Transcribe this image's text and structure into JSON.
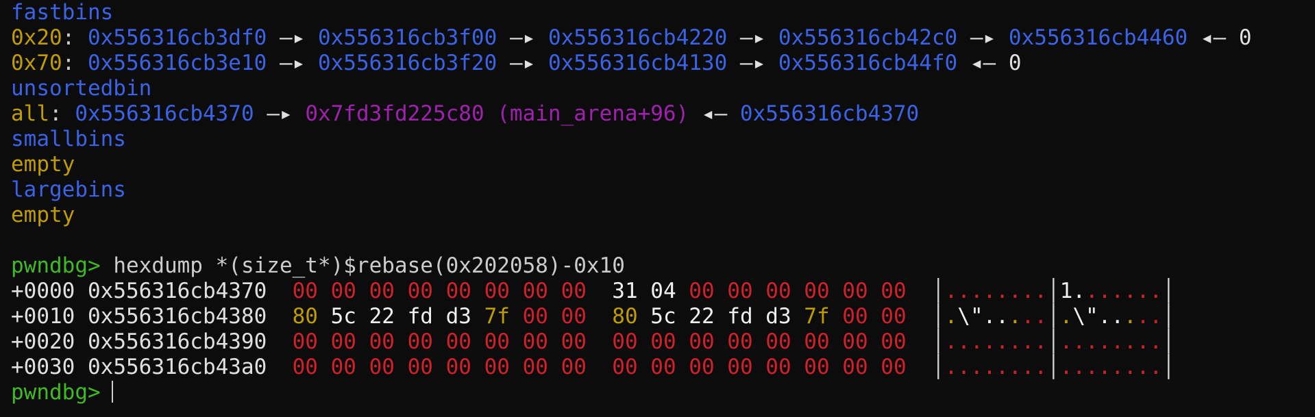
{
  "bins": {
    "fastbins_label": "fastbins",
    "fast_rows": [
      {
        "key": "0x20",
        "chain": [
          "0x556316cb3df0",
          "0x556316cb3f00",
          "0x556316cb4220",
          "0x556316cb42c0",
          "0x556316cb4460"
        ],
        "terminal": "0"
      },
      {
        "key": "0x70",
        "chain": [
          "0x556316cb3e10",
          "0x556316cb3f20",
          "0x556316cb4130",
          "0x556316cb44f0"
        ],
        "terminal": "0"
      }
    ],
    "unsorted_label": "unsortedbin",
    "unsorted_row": {
      "key": "all",
      "first": "0x556316cb4370",
      "libc": "0x7fd3fd225c80 (main_arena+96)",
      "last": "0x556316cb4370"
    },
    "small_label": "smallbins",
    "small_value": "empty",
    "large_label": "largebins",
    "large_value": "empty"
  },
  "symbols": {
    "arrow": "—▸",
    "back_arrow": "◂—",
    "colon": ":"
  },
  "command": {
    "prompt": "pwndbg>",
    "text": "hexdump *(size_t*)$rebase(0x202058)-0x10"
  },
  "hexdump": {
    "rows": [
      {
        "offset": "+0000",
        "address": "0x556316cb4370",
        "bytes": [
          {
            "v": "00",
            "k": "zero"
          },
          {
            "v": "00",
            "k": "zero"
          },
          {
            "v": "00",
            "k": "zero"
          },
          {
            "v": "00",
            "k": "zero"
          },
          {
            "v": "00",
            "k": "zero"
          },
          {
            "v": "00",
            "k": "zero"
          },
          {
            "v": "00",
            "k": "zero"
          },
          {
            "v": "00",
            "k": "zero"
          },
          {
            "v": "31",
            "k": "norm"
          },
          {
            "v": "04",
            "k": "norm"
          },
          {
            "v": "00",
            "k": "zero"
          },
          {
            "v": "00",
            "k": "zero"
          },
          {
            "v": "00",
            "k": "zero"
          },
          {
            "v": "00",
            "k": "zero"
          },
          {
            "v": "00",
            "k": "zero"
          },
          {
            "v": "00",
            "k": "zero"
          }
        ],
        "ascii": [
          {
            "c": ".",
            "k": "zero"
          },
          {
            "c": ".",
            "k": "zero"
          },
          {
            "c": ".",
            "k": "zero"
          },
          {
            "c": ".",
            "k": "zero"
          },
          {
            "c": ".",
            "k": "zero"
          },
          {
            "c": ".",
            "k": "zero"
          },
          {
            "c": ".",
            "k": "zero"
          },
          {
            "c": ".",
            "k": "zero"
          },
          {
            "c": "1",
            "k": "norm"
          },
          {
            "c": ".",
            "k": "norm"
          },
          {
            "c": ".",
            "k": "zero"
          },
          {
            "c": ".",
            "k": "zero"
          },
          {
            "c": ".",
            "k": "zero"
          },
          {
            "c": ".",
            "k": "zero"
          },
          {
            "c": ".",
            "k": "zero"
          },
          {
            "c": ".",
            "k": "zero"
          }
        ]
      },
      {
        "offset": "+0010",
        "address": "0x556316cb4380",
        "bytes": [
          {
            "v": "80",
            "k": "addr"
          },
          {
            "v": "5c",
            "k": "norm"
          },
          {
            "v": "22",
            "k": "norm"
          },
          {
            "v": "fd",
            "k": "norm"
          },
          {
            "v": "d3",
            "k": "norm"
          },
          {
            "v": "7f",
            "k": "addr"
          },
          {
            "v": "00",
            "k": "zero"
          },
          {
            "v": "00",
            "k": "zero"
          },
          {
            "v": "80",
            "k": "addr"
          },
          {
            "v": "5c",
            "k": "norm"
          },
          {
            "v": "22",
            "k": "norm"
          },
          {
            "v": "fd",
            "k": "norm"
          },
          {
            "v": "d3",
            "k": "norm"
          },
          {
            "v": "7f",
            "k": "addr"
          },
          {
            "v": "00",
            "k": "zero"
          },
          {
            "v": "00",
            "k": "zero"
          }
        ],
        "ascii": [
          {
            "c": ".",
            "k": "addr"
          },
          {
            "c": "\\",
            "k": "norm"
          },
          {
            "c": "\"",
            "k": "norm"
          },
          {
            "c": ".",
            "k": "norm"
          },
          {
            "c": ".",
            "k": "norm"
          },
          {
            "c": ".",
            "k": "addr"
          },
          {
            "c": ".",
            "k": "zero"
          },
          {
            "c": ".",
            "k": "zero"
          },
          {
            "c": ".",
            "k": "addr"
          },
          {
            "c": "\\",
            "k": "norm"
          },
          {
            "c": "\"",
            "k": "norm"
          },
          {
            "c": ".",
            "k": "norm"
          },
          {
            "c": ".",
            "k": "norm"
          },
          {
            "c": ".",
            "k": "addr"
          },
          {
            "c": ".",
            "k": "zero"
          },
          {
            "c": ".",
            "k": "zero"
          }
        ]
      },
      {
        "offset": "+0020",
        "address": "0x556316cb4390",
        "bytes": [
          {
            "v": "00",
            "k": "zero"
          },
          {
            "v": "00",
            "k": "zero"
          },
          {
            "v": "00",
            "k": "zero"
          },
          {
            "v": "00",
            "k": "zero"
          },
          {
            "v": "00",
            "k": "zero"
          },
          {
            "v": "00",
            "k": "zero"
          },
          {
            "v": "00",
            "k": "zero"
          },
          {
            "v": "00",
            "k": "zero"
          },
          {
            "v": "00",
            "k": "zero"
          },
          {
            "v": "00",
            "k": "zero"
          },
          {
            "v": "00",
            "k": "zero"
          },
          {
            "v": "00",
            "k": "zero"
          },
          {
            "v": "00",
            "k": "zero"
          },
          {
            "v": "00",
            "k": "zero"
          },
          {
            "v": "00",
            "k": "zero"
          },
          {
            "v": "00",
            "k": "zero"
          }
        ],
        "ascii": [
          {
            "c": ".",
            "k": "zero"
          },
          {
            "c": ".",
            "k": "zero"
          },
          {
            "c": ".",
            "k": "zero"
          },
          {
            "c": ".",
            "k": "zero"
          },
          {
            "c": ".",
            "k": "zero"
          },
          {
            "c": ".",
            "k": "zero"
          },
          {
            "c": ".",
            "k": "zero"
          },
          {
            "c": ".",
            "k": "zero"
          },
          {
            "c": ".",
            "k": "zero"
          },
          {
            "c": ".",
            "k": "zero"
          },
          {
            "c": ".",
            "k": "zero"
          },
          {
            "c": ".",
            "k": "zero"
          },
          {
            "c": ".",
            "k": "zero"
          },
          {
            "c": ".",
            "k": "zero"
          },
          {
            "c": ".",
            "k": "zero"
          },
          {
            "c": ".",
            "k": "zero"
          }
        ]
      },
      {
        "offset": "+0030",
        "address": "0x556316cb43a0",
        "bytes": [
          {
            "v": "00",
            "k": "zero"
          },
          {
            "v": "00",
            "k": "zero"
          },
          {
            "v": "00",
            "k": "zero"
          },
          {
            "v": "00",
            "k": "zero"
          },
          {
            "v": "00",
            "k": "zero"
          },
          {
            "v": "00",
            "k": "zero"
          },
          {
            "v": "00",
            "k": "zero"
          },
          {
            "v": "00",
            "k": "zero"
          },
          {
            "v": "00",
            "k": "zero"
          },
          {
            "v": "00",
            "k": "zero"
          },
          {
            "v": "00",
            "k": "zero"
          },
          {
            "v": "00",
            "k": "zero"
          },
          {
            "v": "00",
            "k": "zero"
          },
          {
            "v": "00",
            "k": "zero"
          },
          {
            "v": "00",
            "k": "zero"
          },
          {
            "v": "00",
            "k": "zero"
          }
        ],
        "ascii": [
          {
            "c": ".",
            "k": "zero"
          },
          {
            "c": ".",
            "k": "zero"
          },
          {
            "c": ".",
            "k": "zero"
          },
          {
            "c": ".",
            "k": "zero"
          },
          {
            "c": ".",
            "k": "zero"
          },
          {
            "c": ".",
            "k": "zero"
          },
          {
            "c": ".",
            "k": "zero"
          },
          {
            "c": ".",
            "k": "zero"
          },
          {
            "c": ".",
            "k": "zero"
          },
          {
            "c": ".",
            "k": "zero"
          },
          {
            "c": ".",
            "k": "zero"
          },
          {
            "c": ".",
            "k": "zero"
          },
          {
            "c": ".",
            "k": "zero"
          },
          {
            "c": ".",
            "k": "zero"
          },
          {
            "c": ".",
            "k": "zero"
          },
          {
            "c": ".",
            "k": "zero"
          }
        ]
      }
    ]
  },
  "final_prompt": "pwndbg>",
  "colors": {
    "background": "#0c0c0c",
    "pointer_blue": "#3a63e8",
    "libc_purple": "#a020b0",
    "key_yellow": "#c19c00",
    "prompt_green": "#3fba23",
    "null_red": "#d0212a"
  }
}
